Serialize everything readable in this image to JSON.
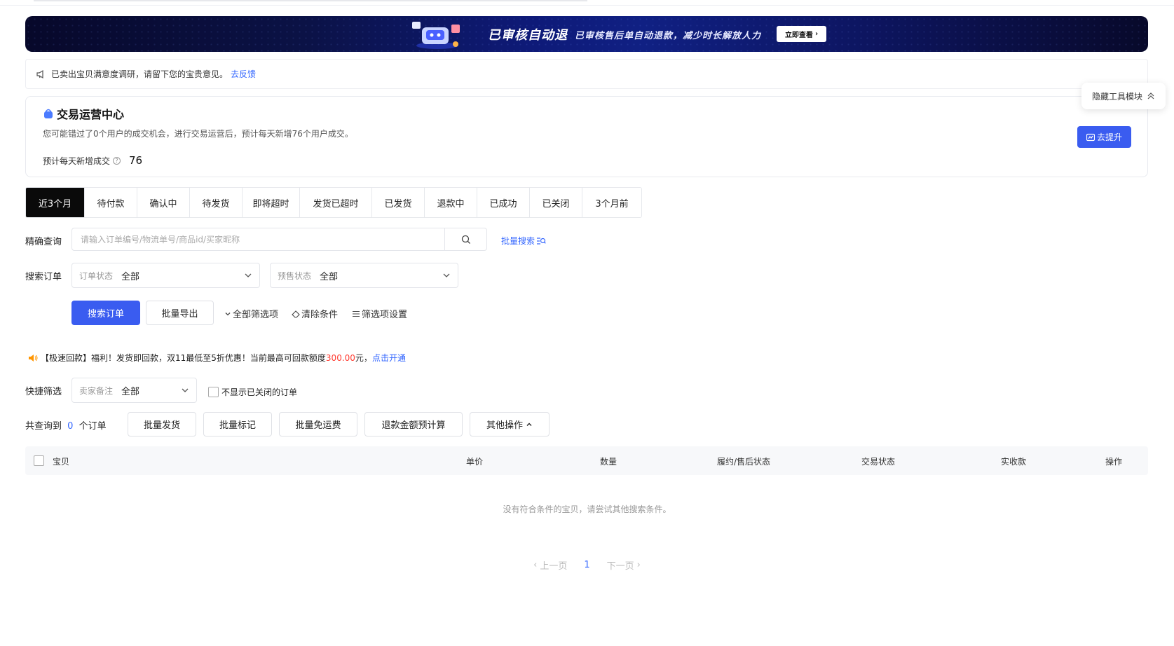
{
  "banner": {
    "title": "已审核自动退",
    "subtitle": "已审核售后单自动退款，减少时长解放人力",
    "button": "立即查看"
  },
  "notice": {
    "text": "已卖出宝贝满意度调研，请留下您的宝贵意见。",
    "link": "去反馈"
  },
  "ops": {
    "title": "交易运营中心",
    "desc": "您可能错过了0个用户的成交机会，进行交易运营后，预计每天新增76个用户成交。",
    "kpi_label": "预计每天新增成交",
    "kpi_value": "76",
    "button": "去提升",
    "hide_tools": "隐藏工具模块"
  },
  "tabs": [
    "近3个月",
    "待付款",
    "确认中",
    "待发货",
    "即将超时",
    "发货已超时",
    "已发货",
    "退款中",
    "已成功",
    "已关闭",
    "3个月前"
  ],
  "search": {
    "label": "精确查询",
    "placeholder": "请输入订单编号/物流单号/商品id/买家昵称",
    "batch_link": "批量搜索"
  },
  "filter": {
    "label": "搜索订单",
    "order_status_key": "订单状态",
    "order_status_value": "全部",
    "presale_key": "预售状态",
    "presale_value": "全部"
  },
  "actions": {
    "search": "搜索订单",
    "export": "批量导出",
    "all_filters": "全部筛选项",
    "clear": "清除条件",
    "filter_settings": "筛选项设置"
  },
  "promo": {
    "prefix": "【极速回款】福利！发货即回款，双11最低至5折优惠！当前最高可回款额度",
    "amount": "300.00",
    "suffix": "元，",
    "link": "点击开通"
  },
  "quick": {
    "label": "快捷筛选",
    "remark_key": "卖家备注",
    "remark_value": "全部",
    "hide_closed": "不显示已关闭的订单"
  },
  "result": {
    "prefix": "共查询到",
    "count": "0",
    "suffix": "个订单",
    "buttons": [
      "批量发货",
      "批量标记",
      "批量免运费",
      "退款金额预计算",
      "其他操作"
    ]
  },
  "table": {
    "columns": [
      "宝贝",
      "单价",
      "数量",
      "履约/售后状态",
      "交易状态",
      "实收款",
      "操作"
    ],
    "empty": "没有符合条件的宝贝，请尝试其他搜索条件。"
  },
  "pager": {
    "prev": "上一页",
    "current": "1",
    "next": "下一页"
  },
  "colors": {
    "primary": "#3a5cf0",
    "link": "#3366ff",
    "active_tab": "#0a0a0a",
    "amount": "#ff3b30"
  }
}
